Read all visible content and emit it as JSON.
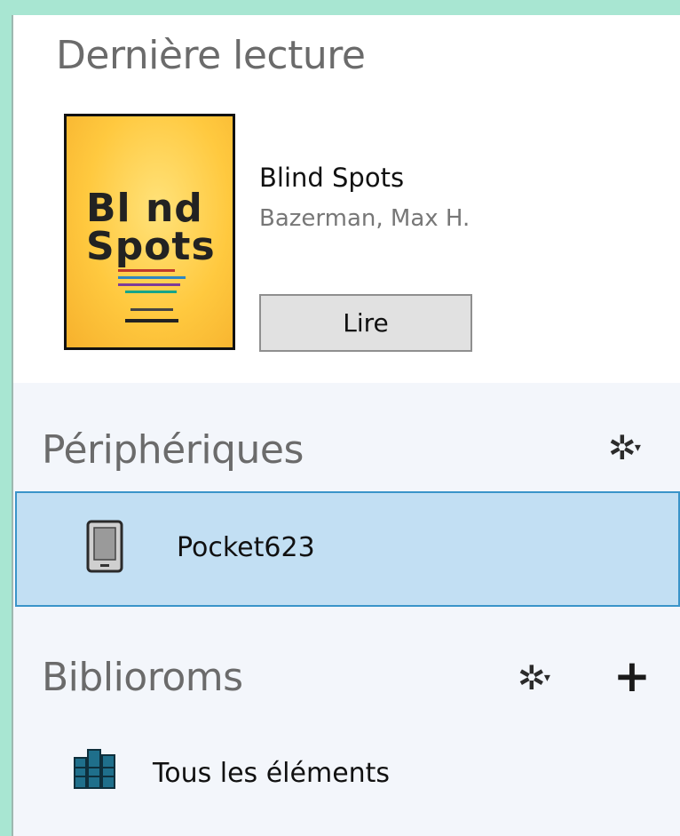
{
  "recent": {
    "title": "Dernière lecture",
    "book": {
      "title": "Blind Spots",
      "author": "Bazerman, Max H.",
      "read_label": "Lire",
      "cover_line1": "Bl nd",
      "cover_line2": "Spots"
    }
  },
  "devices": {
    "title": "Périphériques",
    "items": [
      {
        "name": "Pocket623",
        "selected": true
      }
    ]
  },
  "bibliorooms": {
    "title": "Biblioroms",
    "items": [
      {
        "name": "Tous les éléments"
      }
    ]
  },
  "colors": {
    "background": "#a8e6d2",
    "panel": "#f3f6fb",
    "selection": "#c2dff3",
    "selection_border": "#3a94c9",
    "cover": "#ffc93f"
  }
}
